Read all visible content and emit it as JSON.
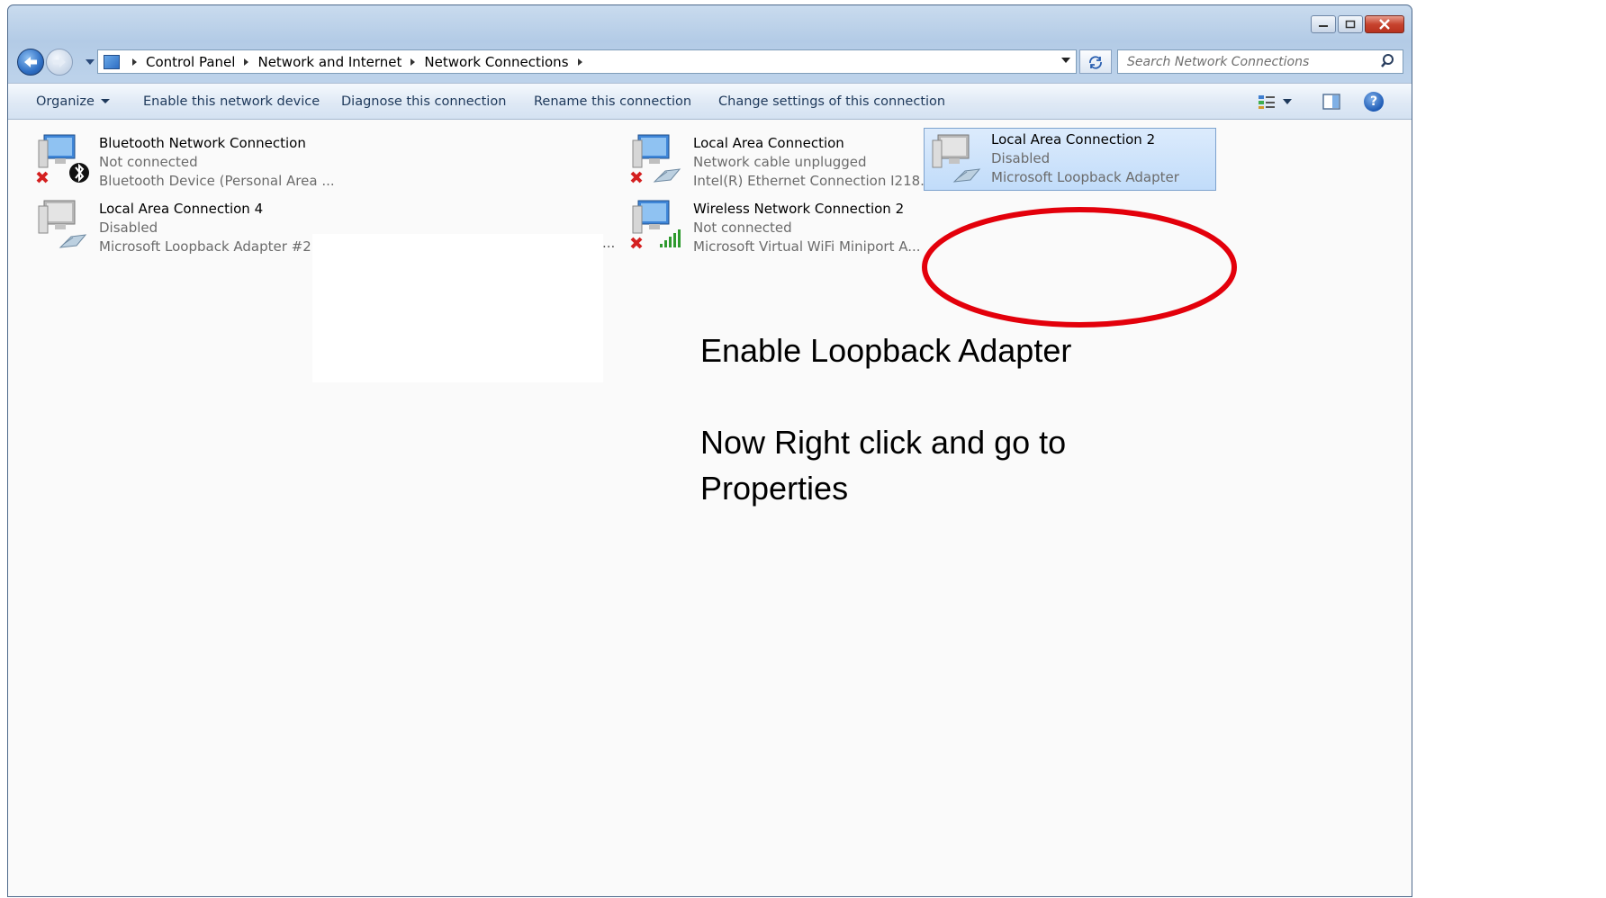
{
  "window": {
    "breadcrumb": [
      "Control Panel",
      "Network and Internet",
      "Network Connections"
    ],
    "search_placeholder": "Search Network Connections"
  },
  "toolbar": {
    "organize": "Organize",
    "enable": "Enable this network device",
    "diagnose": "Diagnose this connection",
    "rename": "Rename this connection",
    "change": "Change settings of this connection"
  },
  "connections": [
    {
      "name": "Bluetooth Network Connection",
      "status": "Not connected",
      "device": "Bluetooth Device (Personal Area ..."
    },
    {
      "name": "Local Area Connection 4",
      "status": "Disabled",
      "device": "Microsoft Loopback Adapter #2"
    },
    {
      "name": "Local Area Connection",
      "status": "Network cable unplugged",
      "device": "Intel(R) Ethernet Connection I218..."
    },
    {
      "name": "Wireless Network Connection 2",
      "status": "Not connected",
      "device": "Microsoft Virtual WiFi Miniport A..."
    },
    {
      "name": "Local Area Connection 2",
      "status": "Disabled",
      "device": "Microsoft Loopback Adapter"
    }
  ],
  "overflow_ellipsis": "...",
  "annotation": {
    "line1": "Enable Loopback Adapter",
    "line2": "Now Right click and go to",
    "line3": "Properties",
    "highlight_color": "#e3000b"
  }
}
